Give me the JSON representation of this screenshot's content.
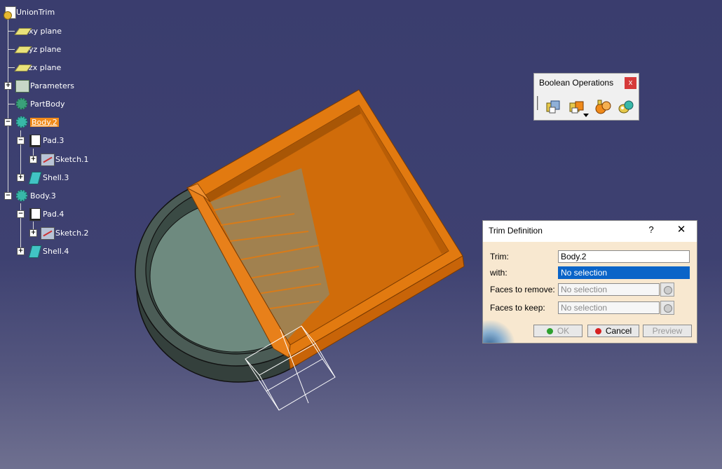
{
  "tree": {
    "items": [
      {
        "label": "UnionTrim",
        "icon": "part-document-icon"
      },
      {
        "label": "xy plane",
        "icon": "plane-icon"
      },
      {
        "label": "yz plane",
        "icon": "plane-icon"
      },
      {
        "label": "zx plane",
        "icon": "plane-icon"
      },
      {
        "label": "Parameters",
        "icon": "parameters-icon"
      },
      {
        "label": "PartBody",
        "icon": "body-gear-icon"
      },
      {
        "label": "Body.2",
        "icon": "body-gear-icon",
        "selected": true
      },
      {
        "label": "Pad.3",
        "icon": "pad-icon"
      },
      {
        "label": "Sketch.1",
        "icon": "sketch-icon"
      },
      {
        "label": "Shell.3",
        "icon": "shell-icon"
      },
      {
        "label": "Body.3",
        "icon": "body-gear-icon"
      },
      {
        "label": "Pad.4",
        "icon": "pad-icon"
      },
      {
        "label": "Sketch.2",
        "icon": "sketch-icon"
      },
      {
        "label": "Shell.4",
        "icon": "shell-icon"
      }
    ]
  },
  "toolbar": {
    "title": "Boolean Operations",
    "close_label": "x",
    "buttons": [
      "assemble-icon",
      "add-icon",
      "union-trim-icon",
      "remove-lump-icon"
    ]
  },
  "dialog": {
    "title": "Trim Definition",
    "help_label": "?",
    "close_label": "✕",
    "trim_label": "Trim:",
    "trim_value": "Body.2",
    "with_label": "with:",
    "with_value": "No selection",
    "remove_label": "Faces to remove:",
    "remove_value": "No selection",
    "keep_label": "Faces to keep:",
    "keep_value": "No selection",
    "ok_label": "OK",
    "cancel_label": "Cancel",
    "preview_label": "Preview"
  },
  "colors": {
    "background_top": "#3a3d6e",
    "model_orange": "#d9700f",
    "model_dark_gray": "#3d4b46",
    "model_light_gray": "#6f8a7f",
    "selection_highlight": "#f08a1a",
    "dialog_body": "#f8e8d0",
    "active_field": "#0a64c8"
  }
}
